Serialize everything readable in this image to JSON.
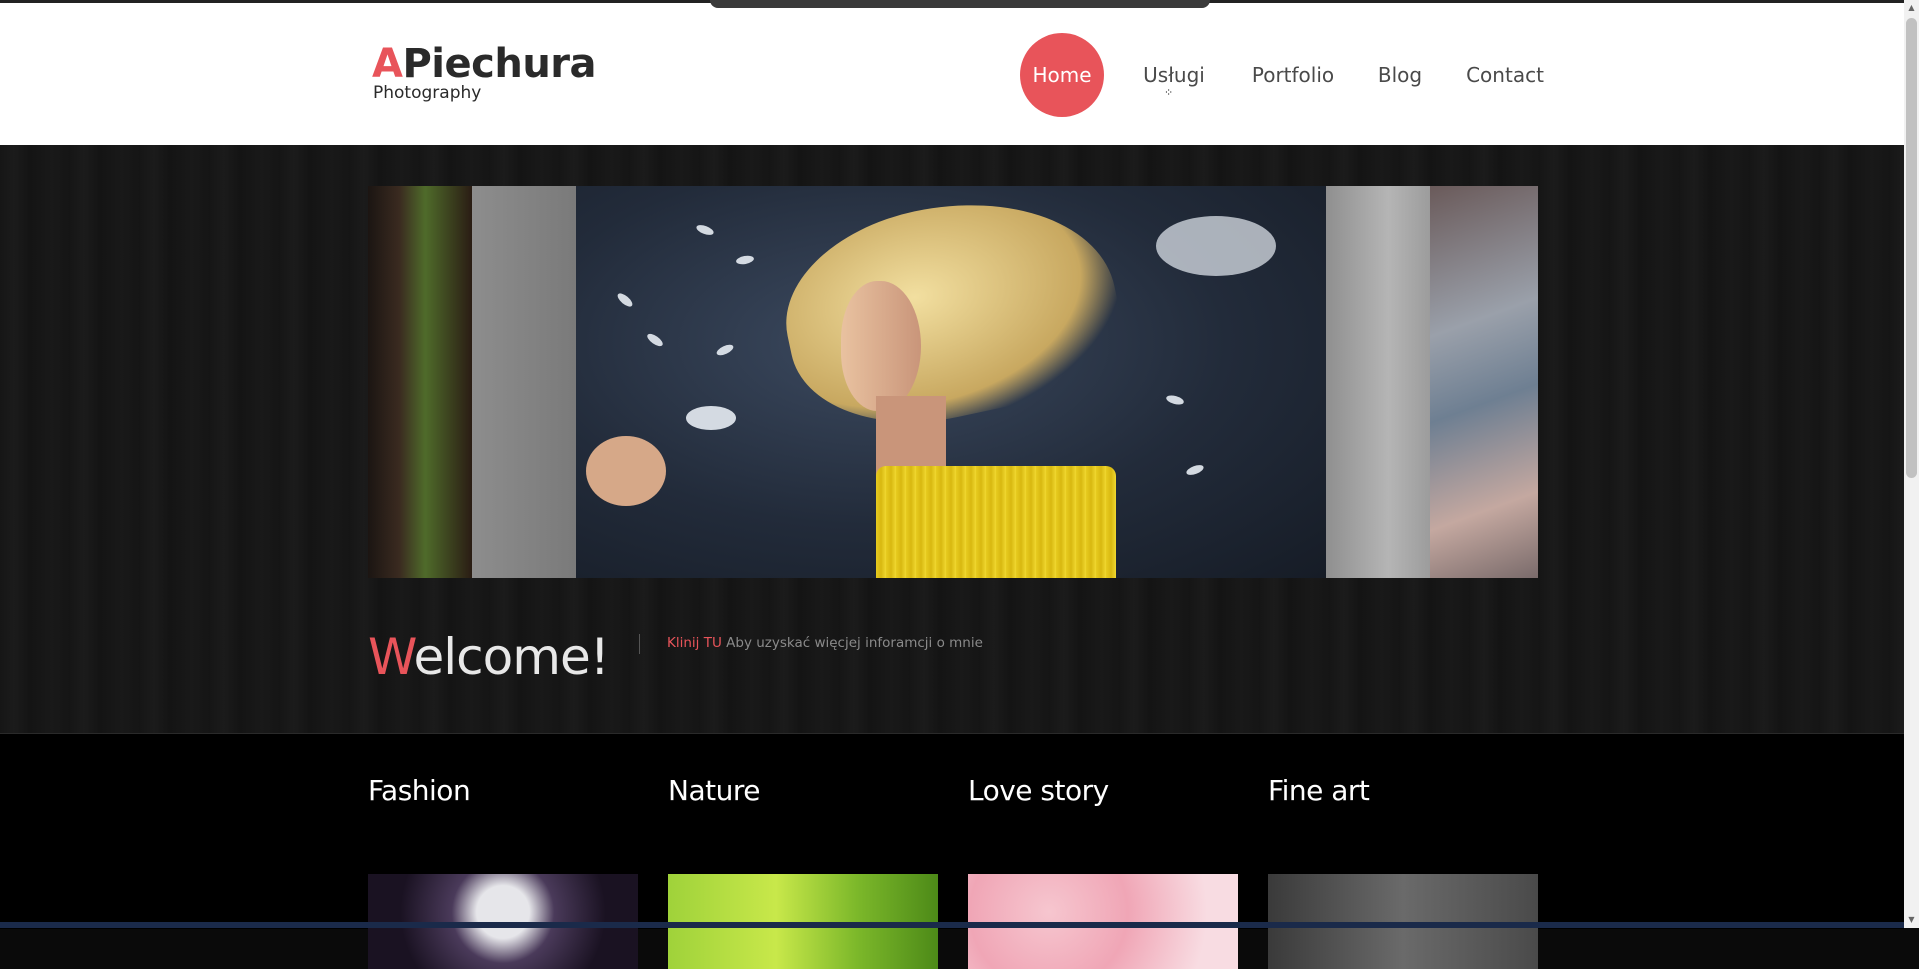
{
  "logo": {
    "accent_letter": "A",
    "name_rest": "Piechura",
    "subtitle": "Photography"
  },
  "nav": {
    "items": [
      {
        "label": "Home",
        "active": true
      },
      {
        "label": "Usługi"
      },
      {
        "label": "Portfolio"
      },
      {
        "label": "Blog"
      },
      {
        "label": "Contact"
      }
    ]
  },
  "hero": {
    "welcome_accent": "W",
    "welcome_rest": "elcome!",
    "link_text": "Klinij TU",
    "link_rest": " Aby uzyskać więcjej inforamcji o mnie"
  },
  "categories": [
    {
      "title": "Fashion"
    },
    {
      "title": "Nature"
    },
    {
      "title": "Love story"
    },
    {
      "title": "Fine art"
    }
  ],
  "colors": {
    "accent": "#e8545a",
    "header_bg": "#ffffff",
    "hero_bg": "#171717",
    "categories_bg": "#000000"
  }
}
